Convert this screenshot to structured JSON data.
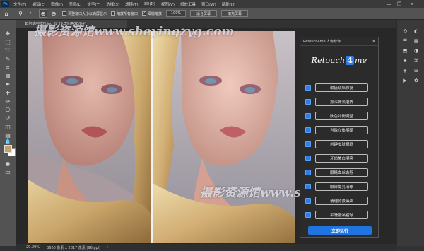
{
  "menu": {
    "items": [
      "文件(F)",
      "编辑(E)",
      "图像(I)",
      "图层(L)",
      "文字(Y)",
      "选择(S)",
      "滤镜(T)",
      "3D(D)",
      "视图(V)",
      "增效工具",
      "窗口(W)",
      "帮助(H)"
    ],
    "logo": "Ps"
  },
  "window_controls": {
    "minimize": "—",
    "restore": "❐",
    "close": "✕"
  },
  "options": {
    "resize_windows": "调整窗口大小以满屏显示",
    "zoom_all": "缩放所有窗口",
    "scrubby_zoom": "细微缩放",
    "zoom_value": "100%",
    "fit_screen": "适合屏幕",
    "fill_screen": "填充屏幕"
  },
  "document": {
    "tab_title": "如何使用技巧.jpg @ 29.3%(RGB/8#)"
  },
  "watermark": {
    "text1": "摄影资源馆www.sheyingzyg.com",
    "text2": "摄影资源馆www.sheying"
  },
  "retouch_panel": {
    "title": "Retouch4me 人像修饰",
    "close": "✕",
    "logo_left": "Retouch",
    "logo_mid": "4",
    "logo_right": "me",
    "options": [
      "瑕疵缺陷修复",
      "加深减淡磨皮",
      "肤色均衡调整",
      "肖像立体明暗",
      "创建皮肤眼眶",
      "牙齿美白明亮",
      "眼睛血丝去除",
      "眼部提亮清晰",
      "清理背景噪声",
      "平滑服装褶皱"
    ],
    "run_label": "立即运行",
    "accent": "#1f74e0"
  },
  "status": {
    "zoom": "29.29%",
    "dimensions": "3600 像素 x 2817 像素 (96 ppi)",
    "arrow": "›"
  },
  "colors": {
    "foreground": "#c5a06a",
    "background": "#ffffff"
  }
}
